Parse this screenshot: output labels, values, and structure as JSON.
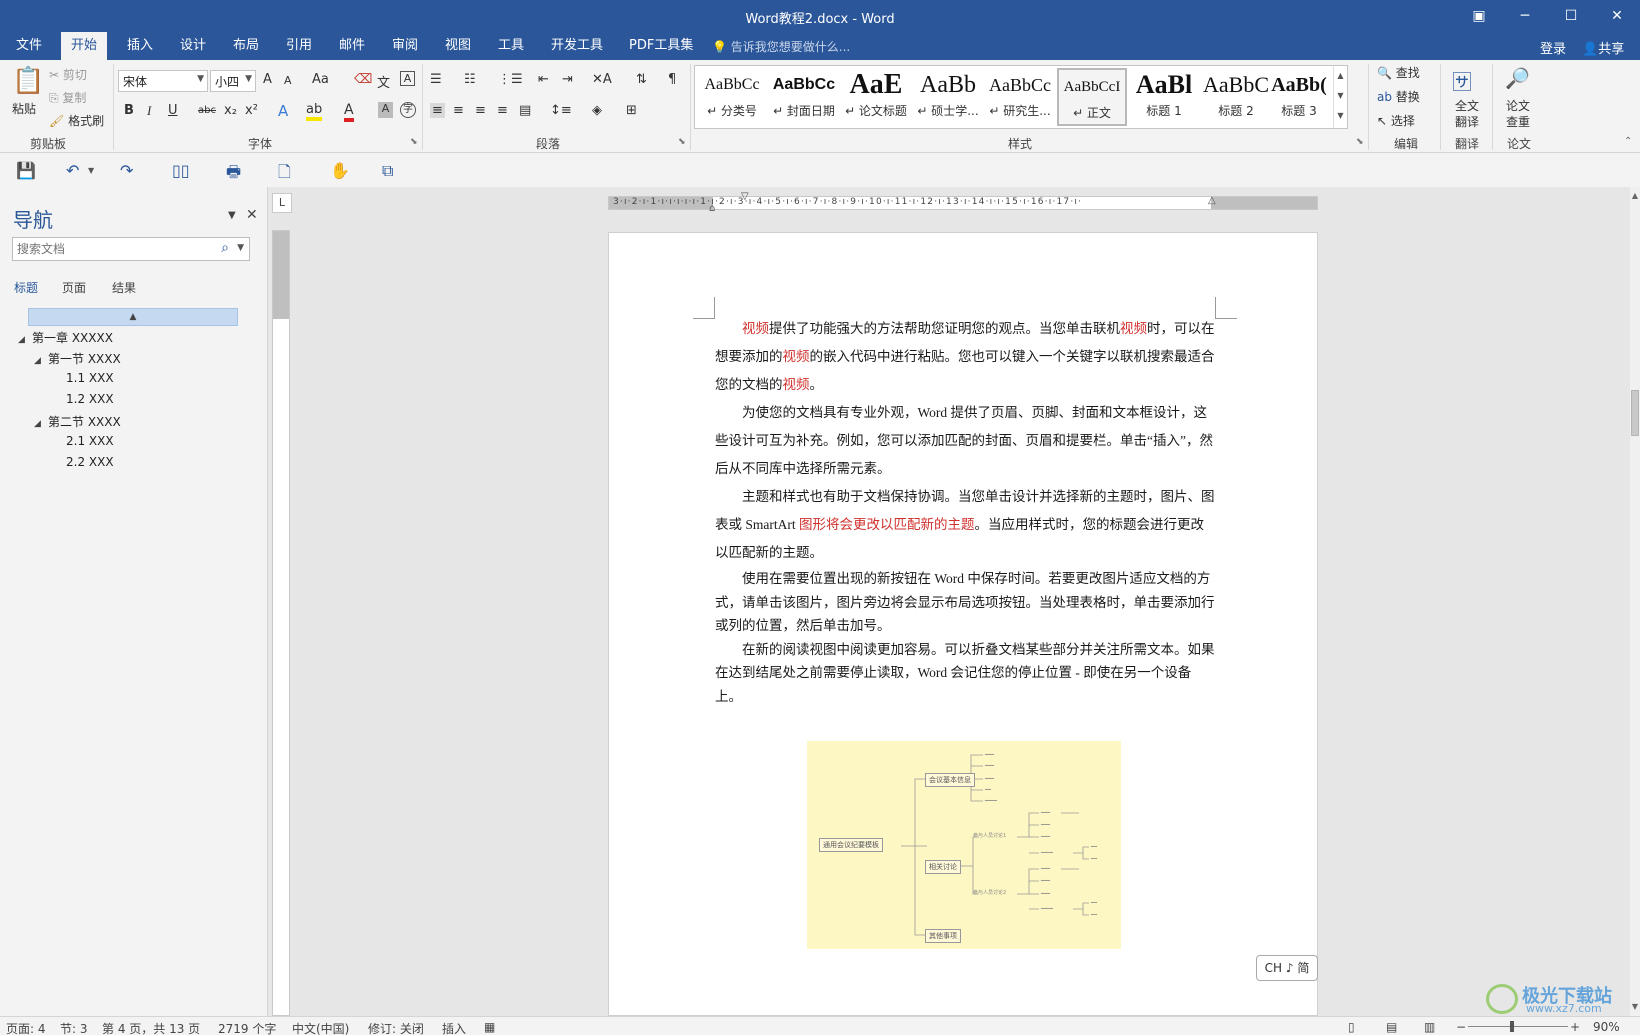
{
  "app": {
    "title": "Word教程2.docx - Word",
    "window_buttons": [
      "▣",
      "─",
      "☐",
      "✕"
    ]
  },
  "menu": {
    "tabs": [
      "文件",
      "开始",
      "插入",
      "设计",
      "布局",
      "引用",
      "邮件",
      "审阅",
      "视图",
      "工具",
      "开发工具",
      "PDF工具集"
    ],
    "active": "开始",
    "tell_me": "告诉我您想要做什么...",
    "login": "登录",
    "share": "共享"
  },
  "ribbon": {
    "clipboard": {
      "paste": "粘贴",
      "cut": "剪切",
      "copy": "复制",
      "format_painter": "格式刷",
      "label": "剪贴板"
    },
    "font": {
      "name": "宋体",
      "size": "小四",
      "grow": "A",
      "shrink": "A",
      "case": "Aa",
      "bold": "B",
      "italic": "I",
      "underline": "U",
      "strike": "abc",
      "sub": "x₂",
      "sup": "x²",
      "label": "字体"
    },
    "paragraph": {
      "label": "段落"
    },
    "styles": {
      "label": "样式",
      "items": [
        {
          "sample": "AaBbCc",
          "name": "↵ 分类号"
        },
        {
          "sample": "AaBbCc",
          "name": "↵ 封面日期"
        },
        {
          "sample": "AaE",
          "name": "↵ 论文标题"
        },
        {
          "sample": "AaBb",
          "name": "↵ 硕士学..."
        },
        {
          "sample": "AaBbCc",
          "name": "↵ 研究生..."
        },
        {
          "sample": "AaBbCcI",
          "name": "↵ 正文"
        },
        {
          "sample": "AaBl",
          "name": "标题 1"
        },
        {
          "sample": "AaBbC",
          "name": "标题 2"
        },
        {
          "sample": "AaBb(",
          "name": "标题 3"
        }
      ],
      "selected_index": 5
    },
    "editing": {
      "find": "查找",
      "replace": "替换",
      "select": "选择",
      "label": "编辑"
    },
    "translate": {
      "button": "全文翻译",
      "button_line1": "全文",
      "button_line2": "翻译",
      "label": "翻译"
    },
    "thesis": {
      "button_line1": "论文",
      "button_line2": "查重",
      "label": "论文"
    }
  },
  "nav": {
    "title": "导航",
    "search_placeholder": "搜索文档",
    "tabs": [
      "标题",
      "页面",
      "结果"
    ],
    "active_tab": "标题",
    "tree": [
      {
        "label": "第一章 XXXXX",
        "level": 0,
        "expanded": true
      },
      {
        "label": "第一节 XXXX",
        "level": 1,
        "expanded": true
      },
      {
        "label": "1.1 XXX",
        "level": 2
      },
      {
        "label": "1.2 XXX",
        "level": 2
      },
      {
        "label": "第二节 XXXX",
        "level": 1,
        "expanded": true
      },
      {
        "label": "2.1 XXX",
        "level": 2
      },
      {
        "label": "2.2 XXX",
        "level": 2
      }
    ]
  },
  "document": {
    "p1": {
      "parts": [
        "视频",
        "提供了功能强大的方法帮助您证明您的观点。当您单击联机",
        "视频",
        "时，可以在想要添加的",
        "视频",
        "的嵌入代码中进行粘贴。您也可以键入一个关键字以联机搜索最适合您的文档的",
        "视频",
        "。"
      ]
    },
    "p2": "为使您的文档具有专业外观，Word 提供了页眉、页脚、封面和文本框设计，这些设计可互为补充。例如，您可以添加匹配的封面、页眉和提要栏。单击“插入”，然后从不同库中选择所需元素。",
    "p3": {
      "before": "主题和样式也有助于文档保持协调。当您单击设计并选择新的主题时，图片、图表或 SmartArt ",
      "highlight": "图形将会更改以匹配新的主题",
      "after": "。当应用样式时，您的标题会进行更改以匹配新的主题。"
    },
    "p4": "使用在需要位置出现的新按钮在 Word 中保存时间。若要更改图片适应文档的方式，请单击该图片，图片旁边将会显示布局选项按钮。当处理表格时，单击要添加行或列的位置，然后单击加号。",
    "p5": "在新的阅读视图中阅读更加容易。可以折叠文档某些部分并关注所需文本。如果在达到结尾处之前需要停止读取，Word 会记住您的停止位置 - 即使在另一个设备上。",
    "mindmap": {
      "root": "通用会议纪要模板",
      "branches": [
        "会议基本信息",
        "相关讨论",
        "其他事项"
      ],
      "sub": [
        "参与人员讨论1",
        "参与人员讨论2"
      ]
    }
  },
  "ime": "CH ♪ 简",
  "status": {
    "page": "页面: 4",
    "section": "节: 3",
    "page_of": "第 4 页，共 13 页",
    "words": "2719 个字",
    "language": "中文(中国)",
    "track": "修订: 关闭",
    "mode": "插入",
    "zoom": "90%"
  },
  "watermark": {
    "line1": "极光下载站",
    "line2": "www.xz7.com"
  },
  "colors": {
    "accent": "#2b579a",
    "highlight_text": "#d0312d",
    "mindmap_bg": "#fdf7c3"
  }
}
